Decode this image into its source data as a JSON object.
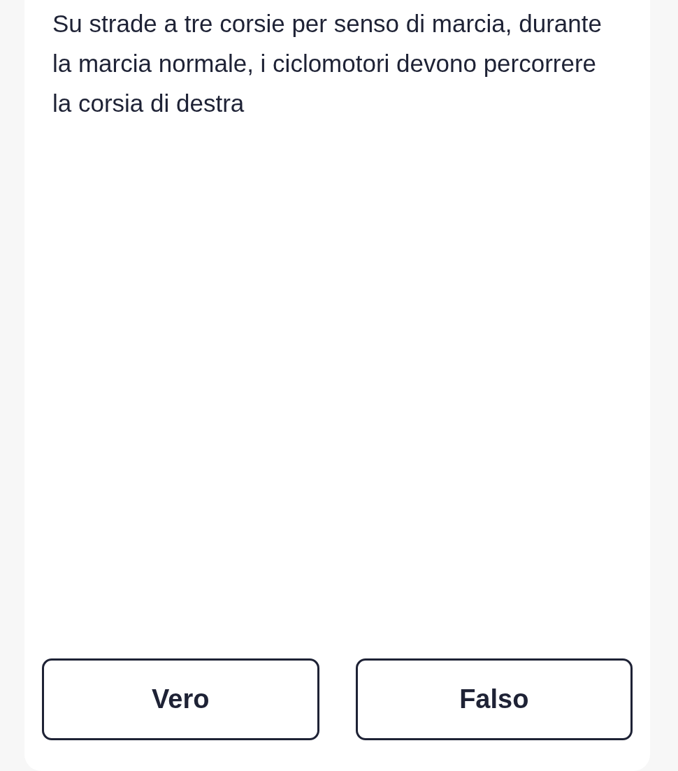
{
  "question": "Su strade a tre corsie per senso di marcia, durante la marcia normale, i ciclomotori devono percorrere la corsia di destra",
  "answers": [
    {
      "label": "Vero"
    },
    {
      "label": "Falso"
    }
  ]
}
